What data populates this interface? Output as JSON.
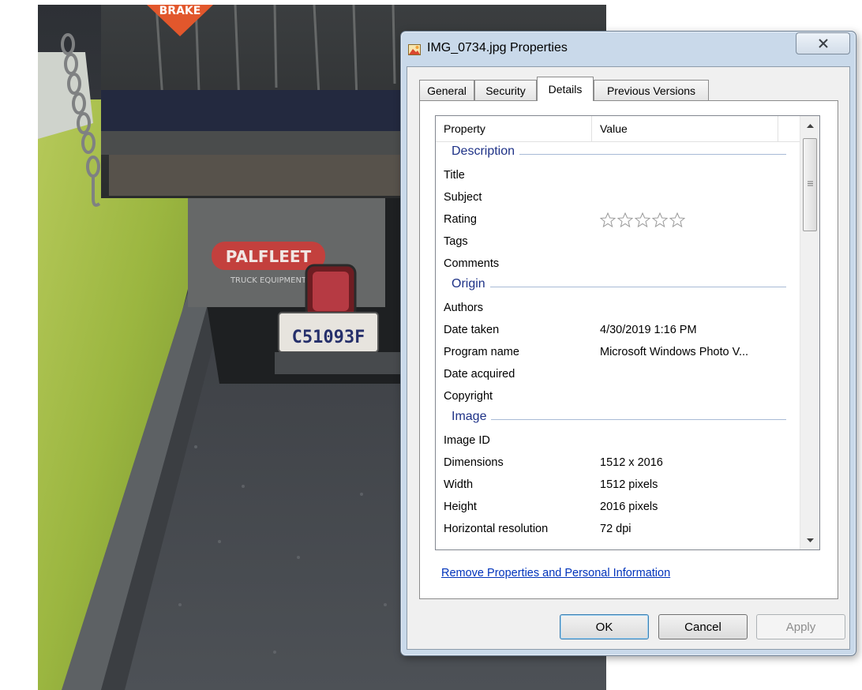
{
  "photo": {
    "sign_text": "BRAKE",
    "mudflap_text": "PALFLEET",
    "mudflap_subtext": "TRUCK EQUIPMENT",
    "plate_text": "C51093F"
  },
  "window": {
    "title": "IMG_0734.jpg Properties",
    "close_icon": "close-icon",
    "tabs": [
      {
        "label": "General"
      },
      {
        "label": "Security"
      },
      {
        "label": "Details"
      },
      {
        "label": "Previous Versions"
      }
    ],
    "active_tab": "Details"
  },
  "details": {
    "headers": {
      "property": "Property",
      "value": "Value"
    },
    "groups": [
      {
        "label": "Description"
      },
      {
        "label": "Origin"
      },
      {
        "label": "Image"
      }
    ],
    "rows": {
      "title": {
        "name": "Title",
        "value": ""
      },
      "subject": {
        "name": "Subject",
        "value": ""
      },
      "rating": {
        "name": "Rating",
        "stars_filled": 0,
        "stars_total": 5
      },
      "tags": {
        "name": "Tags",
        "value": ""
      },
      "comments": {
        "name": "Comments",
        "value": ""
      },
      "authors": {
        "name": "Authors",
        "value": ""
      },
      "date_taken": {
        "name": "Date taken",
        "value": "4/30/2019 1:16 PM"
      },
      "program_name": {
        "name": "Program name",
        "value": "Microsoft Windows Photo V..."
      },
      "date_acquired": {
        "name": "Date acquired",
        "value": ""
      },
      "copyright": {
        "name": "Copyright",
        "value": ""
      },
      "image_id": {
        "name": "Image ID",
        "value": ""
      },
      "dimensions": {
        "name": "Dimensions",
        "value": "1512 x 2016"
      },
      "width": {
        "name": "Width",
        "value": "1512 pixels"
      },
      "height": {
        "name": "Height",
        "value": "2016 pixels"
      },
      "horizontal_resolution": {
        "name": "Horizontal resolution",
        "value": "72 dpi"
      }
    },
    "remove_link": "Remove Properties and Personal Information"
  },
  "buttons": {
    "ok": "OK",
    "cancel": "Cancel",
    "apply": "Apply"
  },
  "colors": {
    "link": "#0033bb",
    "group_header": "#1e3287",
    "frame": "#c9d9ea"
  }
}
